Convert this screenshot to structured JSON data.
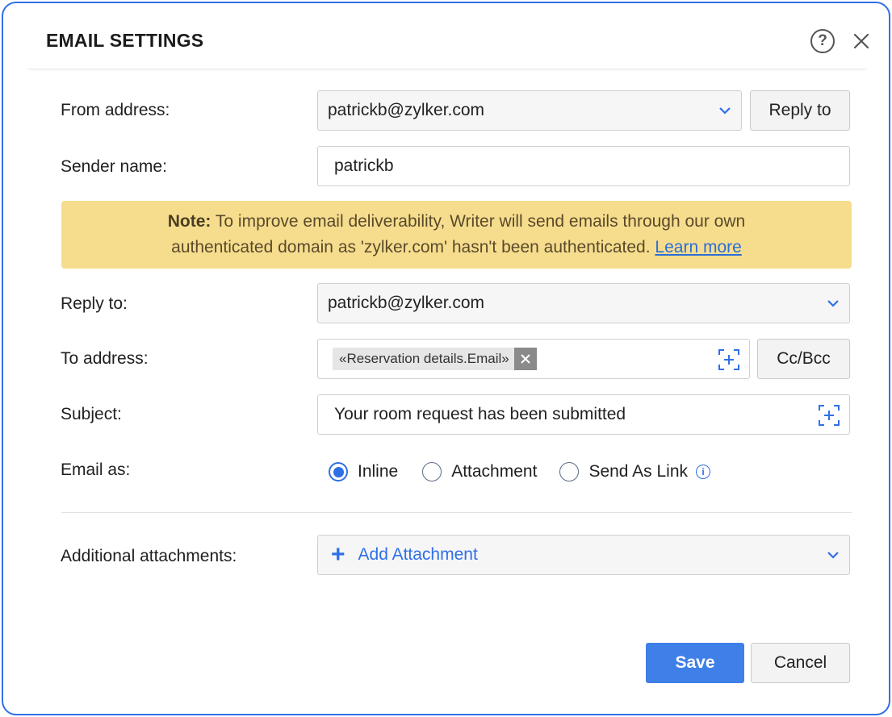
{
  "dialog": {
    "title": "EMAIL SETTINGS",
    "help_icon": "help-icon",
    "close_icon": "close-icon"
  },
  "form": {
    "from_address": {
      "label": "From address:",
      "value": "patrickb@zylker.com",
      "button": "Reply to"
    },
    "sender_name": {
      "label": "Sender name:",
      "value": "patrickb"
    },
    "note": {
      "prefix": "Note:",
      "line1": " To improve email deliverability, Writer will send emails through our own",
      "line2": "authenticated domain as 'zylker.com' hasn't been authenticated. ",
      "link": "Learn more"
    },
    "reply_to": {
      "label": "Reply to:",
      "value": "patrickb@zylker.com"
    },
    "to_address": {
      "label": "To address:",
      "chip": "«Reservation details.Email»",
      "button": "Cc/Bcc"
    },
    "subject": {
      "label": "Subject:",
      "value": "Your room request has been submitted"
    },
    "email_as": {
      "label": "Email as:",
      "options": [
        "Inline",
        "Attachment",
        "Send As Link"
      ],
      "selected": "Inline"
    },
    "additional_attachments": {
      "label": "Additional attachments:",
      "button": "Add Attachment"
    }
  },
  "footer": {
    "save": "Save",
    "cancel": "Cancel"
  },
  "colors": {
    "accent": "#2f6fe6",
    "note_bg": "#f6dd8e",
    "save_bg": "#3f7fe8"
  }
}
